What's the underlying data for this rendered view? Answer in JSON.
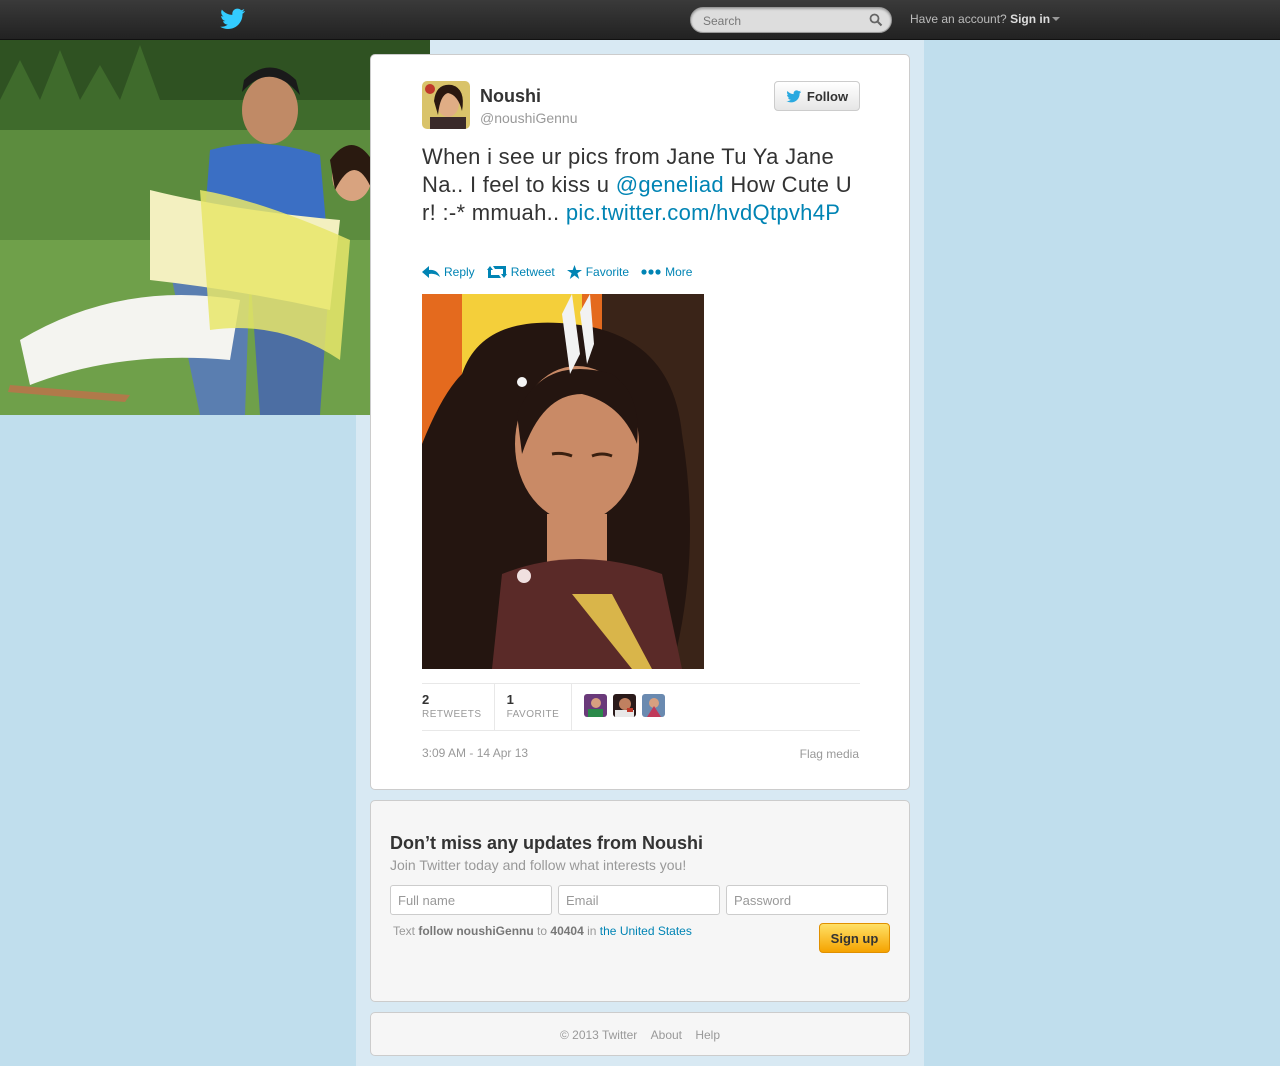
{
  "header": {
    "search_placeholder": "Search",
    "signin_prefix": "Have an account?",
    "signin_label": "Sign in"
  },
  "tweet": {
    "name": "Noushi",
    "handle": "@noushiGennu",
    "follow_label": "Follow",
    "text_part1": "When i see ur pics from Jane Tu Ya Jane Na.. I feel to kiss u ",
    "mention": "@geneliad",
    "text_part2": " How Cute U r! :-* mmuah..",
    "link": "pic.twitter.com/hvdQtpvh4P",
    "actions": {
      "reply": "Reply",
      "retweet": "Retweet",
      "favorite": "Favorite",
      "more": "More"
    },
    "retweets_count": "2",
    "retweets_label": "RETWEETS",
    "favorites_count": "1",
    "favorites_label": "FAVORITE",
    "timestamp": "3:09 AM - 14 Apr 13",
    "flag_label": "Flag media"
  },
  "signup": {
    "title": "Don’t miss any updates from Noushi",
    "subtitle": "Join Twitter today and follow what interests you!",
    "fullname_placeholder": "Full name",
    "email_placeholder": "Email",
    "password_placeholder": "Password",
    "text_prefix": "Text",
    "text_command": "follow noushiGennu",
    "text_to": "to",
    "text_number": "40404",
    "text_in": "in",
    "text_country": "the United States",
    "button_label": "Sign up"
  },
  "footer": {
    "copyright": "© 2013 Twitter",
    "about": "About",
    "help": "Help"
  },
  "colors": {
    "link": "#0084b4",
    "background": "#c0deed"
  }
}
